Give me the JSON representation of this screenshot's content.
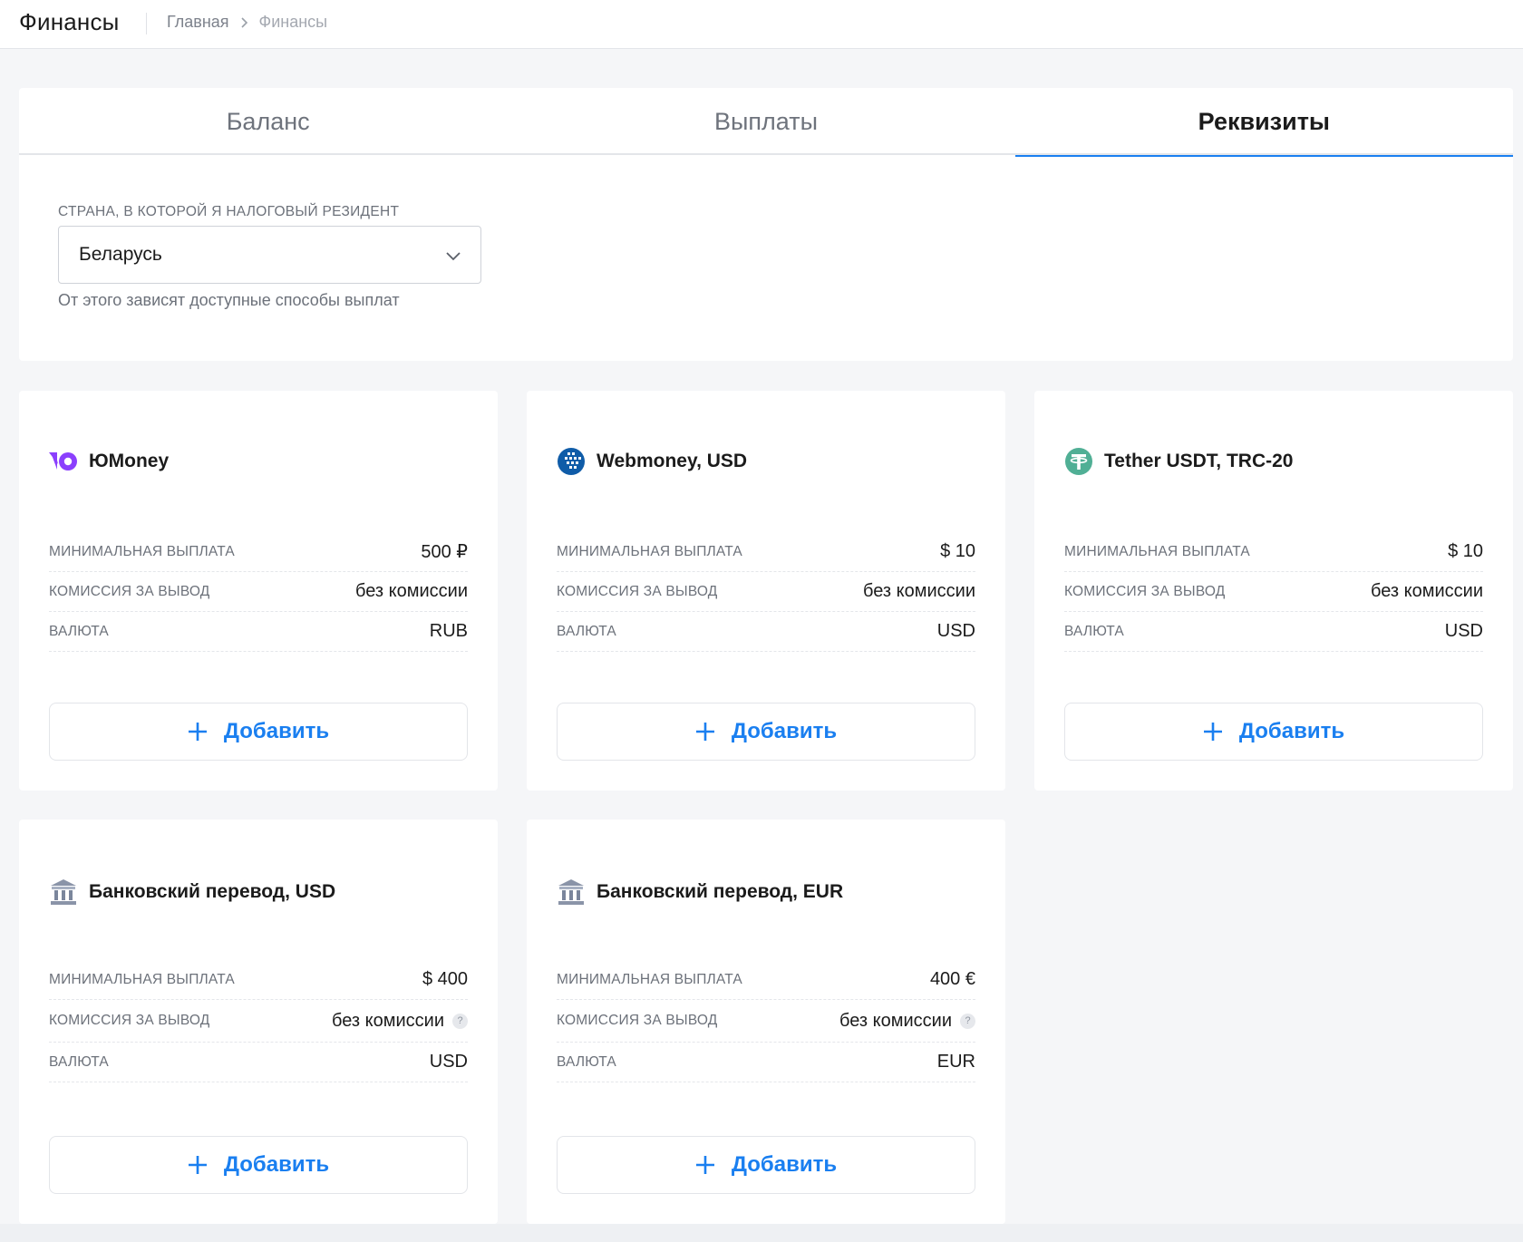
{
  "header": {
    "title": "Финансы",
    "breadcrumb": {
      "home": "Главная",
      "current": "Финансы"
    }
  },
  "tabs": [
    {
      "label": "Баланс",
      "active": false
    },
    {
      "label": "Выплаты",
      "active": false
    },
    {
      "label": "Реквизиты",
      "active": true
    }
  ],
  "country": {
    "label": "СТРАНА, В КОТОРОЙ Я НАЛОГОВЫЙ РЕЗИДЕНТ",
    "value": "Беларусь",
    "hint": "От этого зависят доступные способы выплат"
  },
  "cards": [
    {
      "title": "ЮMoney",
      "icon": "yoomoney-icon",
      "min_label": "МИНИМАЛЬНАЯ ВЫПЛАТА",
      "min_value": "500 ₽",
      "fee_label": "КОМИССИЯ ЗА ВЫВОД",
      "fee_value": "без комиссии",
      "currency_label": "ВАЛЮТА",
      "currency_value": "RUB",
      "add_label": "Добавить"
    },
    {
      "title": "Webmoney, USD",
      "icon": "webmoney-icon",
      "min_label": "МИНИМАЛЬНАЯ ВЫПЛАТА",
      "min_value": "$ 10",
      "fee_label": "КОМИССИЯ ЗА ВЫВОД",
      "fee_value": "без комиссии",
      "currency_label": "ВАЛЮТА",
      "currency_value": "USD",
      "add_label": "Добавить"
    },
    {
      "title": "Tether USDT, TRC-20",
      "icon": "tether-icon",
      "min_label": "МИНИМАЛЬНАЯ ВЫПЛАТА",
      "min_value": "$ 10",
      "fee_label": "КОМИССИЯ ЗА ВЫВОД",
      "fee_value": "без комиссии",
      "currency_label": "ВАЛЮТА",
      "currency_value": "USD",
      "add_label": "Добавить"
    },
    {
      "title": "Банковский перевод, USD",
      "icon": "bank-icon",
      "min_label": "МИНИМАЛЬНАЯ ВЫПЛАТА",
      "min_value": "$ 400",
      "fee_label": "КОМИССИЯ ЗА ВЫВОД",
      "fee_value": "без комиссии",
      "fee_help": "?",
      "currency_label": "ВАЛЮТА",
      "currency_value": "USD",
      "add_label": "Добавить"
    },
    {
      "title": "Банковский перевод, EUR",
      "icon": "bank-icon",
      "min_label": "МИНИМАЛЬНАЯ ВЫПЛАТА",
      "min_value": "400 €",
      "fee_label": "КОМИССИЯ ЗА ВЫВОД",
      "fee_value": "без комиссии",
      "fee_help": "?",
      "currency_label": "ВАЛЮТА",
      "currency_value": "EUR",
      "add_label": "Добавить"
    }
  ],
  "colors": {
    "accent": "#1a7ff0",
    "yoomoney": "#8b3ffd",
    "webmoney": "#0f5ca8",
    "tether": "#50af95",
    "bank": "#8a94a8"
  }
}
